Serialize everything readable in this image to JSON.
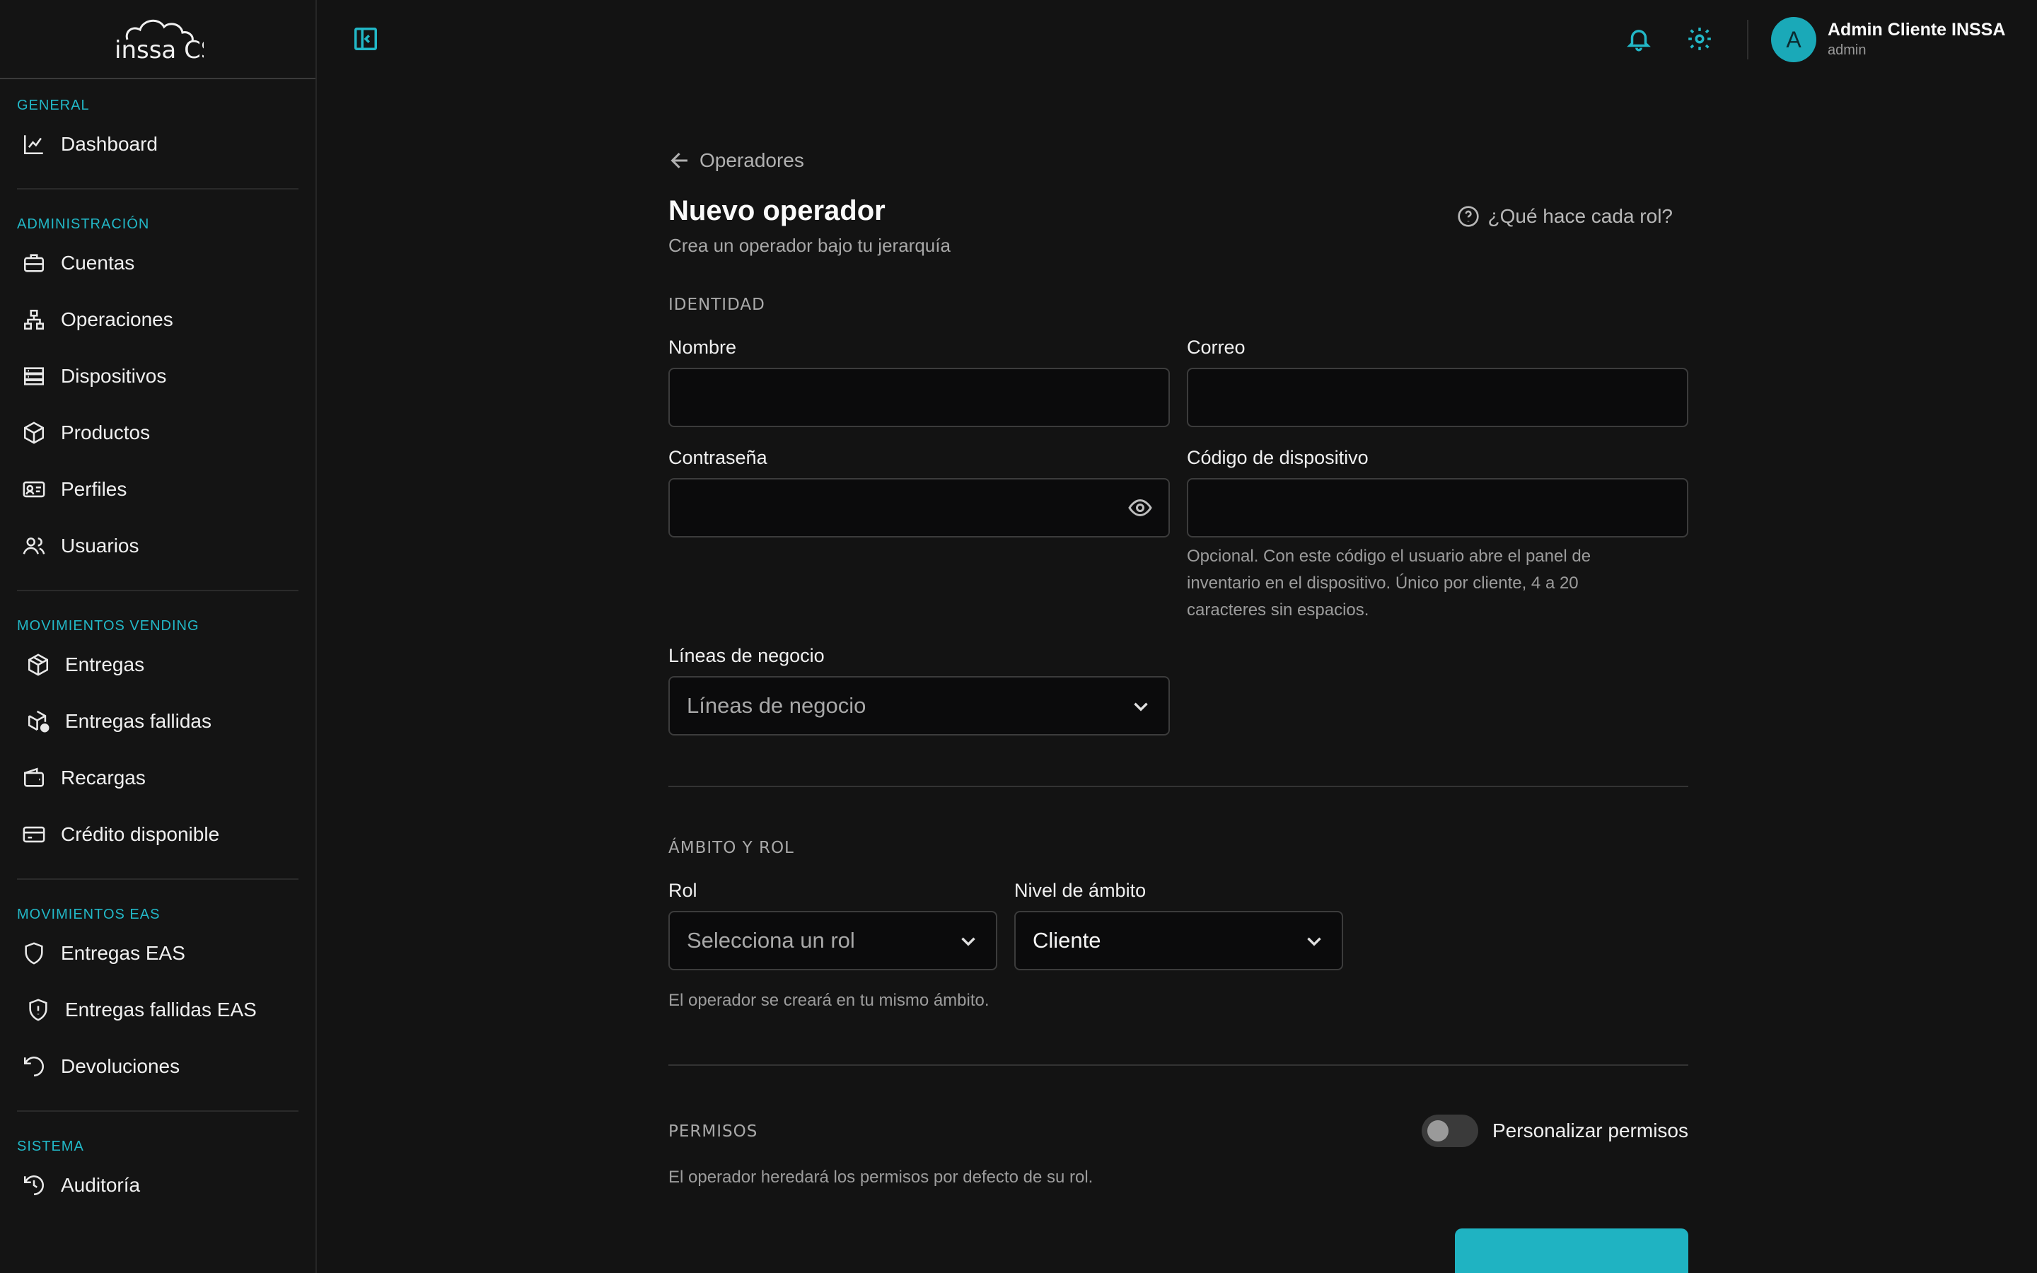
{
  "sidebar": {
    "logo_text": "inssa CS",
    "sections": [
      {
        "label": "GENERAL",
        "items": [
          {
            "label": "Dashboard",
            "icon": "chart-line-icon"
          }
        ]
      },
      {
        "label": "ADMINISTRACIÓN",
        "items": [
          {
            "label": "Cuentas",
            "icon": "briefcase-icon"
          },
          {
            "label": "Operaciones",
            "icon": "hierarchy-icon"
          },
          {
            "label": "Dispositivos",
            "icon": "server-icon"
          },
          {
            "label": "Productos",
            "icon": "box-icon"
          },
          {
            "label": "Perfiles",
            "icon": "id-card-icon"
          },
          {
            "label": "Usuarios",
            "icon": "users-icon"
          }
        ]
      },
      {
        "label": "MOVIMIENTOS VENDING",
        "items": [
          {
            "label": "Entregas",
            "icon": "package-icon"
          },
          {
            "label": "Entregas fallidas",
            "icon": "package-alert-icon"
          },
          {
            "label": "Recargas",
            "icon": "wallet-icon"
          },
          {
            "label": "Crédito disponible",
            "icon": "credit-card-icon"
          }
        ]
      },
      {
        "label": "MOVIMIENTOS EAS",
        "items": [
          {
            "label": "Entregas EAS",
            "icon": "shield-icon"
          },
          {
            "label": "Entregas fallidas EAS",
            "icon": "shield-alert-icon"
          },
          {
            "label": "Devoluciones",
            "icon": "rotate-ccw-icon"
          }
        ]
      },
      {
        "label": "SISTEMA",
        "items": [
          {
            "label": "Auditoría",
            "icon": "history-icon"
          }
        ]
      }
    ]
  },
  "header": {
    "user": {
      "initial": "A",
      "name": "Admin Cliente INSSA",
      "role": "admin"
    }
  },
  "main": {
    "back_label": "Operadores",
    "title": "Nuevo operador",
    "subtitle": "Crea un operador bajo tu jerarquía",
    "help_label": "¿Qué hace cada rol?",
    "identity": {
      "section_title": "IDENTIDAD",
      "name_label": "Nombre",
      "email_label": "Correo",
      "password_label": "Contraseña",
      "device_code_label": "Código de dispositivo",
      "device_code_help": "Opcional. Con este código el usuario abre el panel de inventario en el dispositivo. Único por cliente, 4 a 20 caracteres sin espacios.",
      "business_lines_label": "Líneas de negocio",
      "business_lines_placeholder": "Líneas de negocio"
    },
    "scope": {
      "section_title": "ÁMBITO Y ROL",
      "role_label": "Rol",
      "role_placeholder": "Selecciona un rol",
      "scope_level_label": "Nivel de ámbito",
      "scope_level_value": "Cliente",
      "note": "El operador se creará en tu mismo ámbito."
    },
    "permissions": {
      "section_title": "PERMISOS",
      "toggle_label": "Personalizar permisos",
      "toggle_on": false,
      "note": "El operador heredará los permisos por defecto de su rol."
    }
  },
  "colors": {
    "accent": "#22b8c7",
    "background": "#131313",
    "sidebar": "#141414"
  }
}
